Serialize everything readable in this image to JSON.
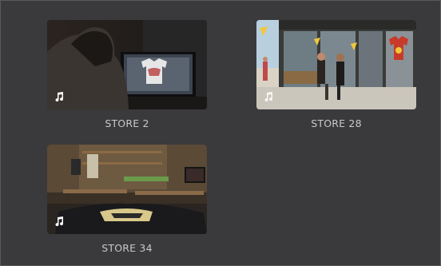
{
  "bin": {
    "clips": [
      {
        "name": "STORE 2",
        "has_audio": true,
        "audio_icon": "music-note-icon"
      },
      {
        "name": "STORE 28",
        "has_audio": true,
        "audio_icon": "music-note-icon"
      },
      {
        "name": "STORE 34",
        "has_audio": true,
        "audio_icon": "music-note-icon"
      }
    ]
  },
  "colors": {
    "panel_background": "#3a3a3c",
    "label_text": "#c8c8c8"
  }
}
